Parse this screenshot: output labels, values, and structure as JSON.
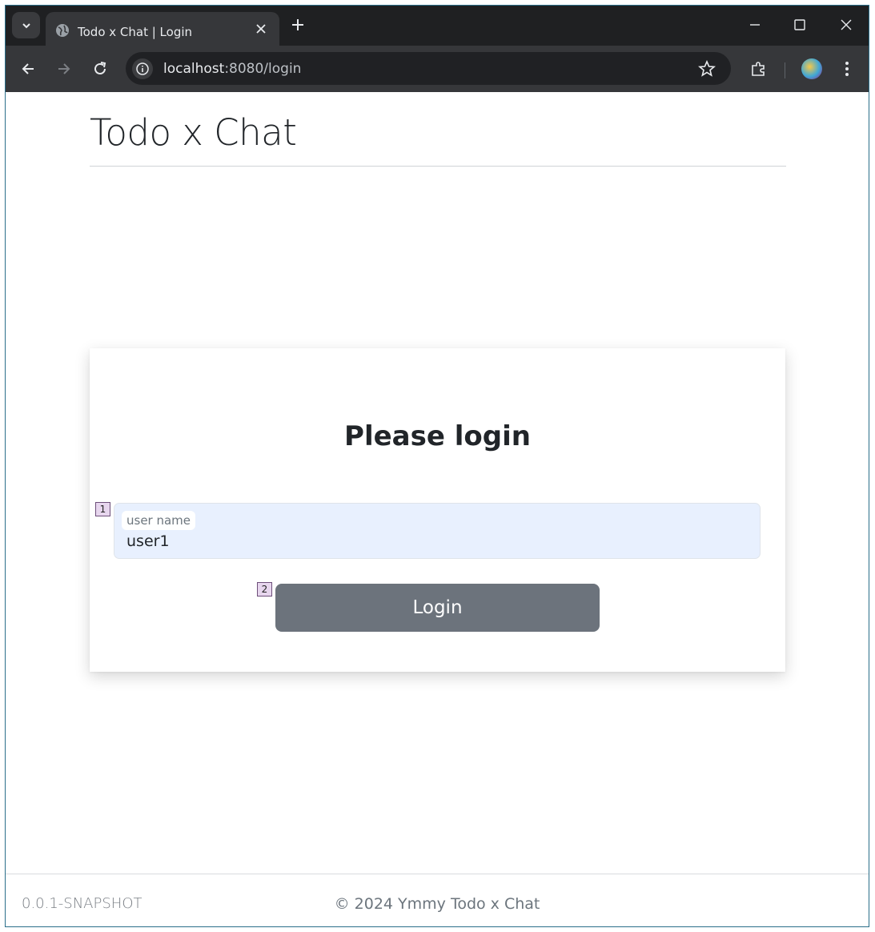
{
  "browser": {
    "tab_title": "Todo x Chat | Login",
    "url_host": "localhost",
    "url_path": ":8080/login"
  },
  "header": {
    "brand": "Todo x Chat"
  },
  "login": {
    "heading": "Please login",
    "username_label": "user name",
    "username_value": "user1",
    "submit_label": "Login"
  },
  "markers": {
    "field": "1",
    "button": "2"
  },
  "footer": {
    "version": "0.0.1-SNAPSHOT",
    "copyright": "© 2024 Ymmy Todo x Chat"
  },
  "colors": {
    "button": "#6c737c",
    "input_bg": "#e8f0fe",
    "chrome_dark": "#1f2022"
  }
}
